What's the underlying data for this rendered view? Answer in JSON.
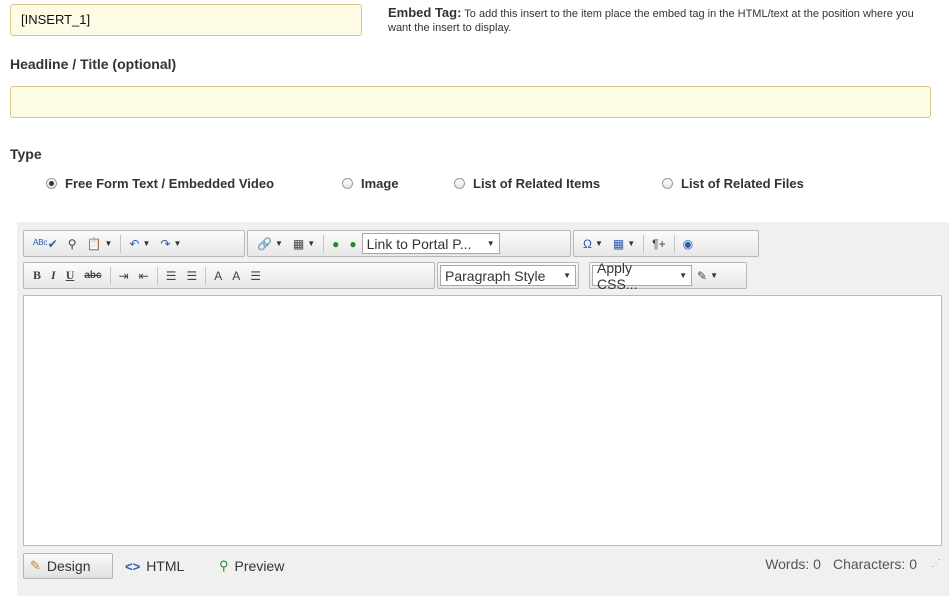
{
  "embed": {
    "value": "[INSERT_1]",
    "tag_label": "Embed Tag:",
    "tag_help": "To add this insert to the item place the embed tag in the HTML/text at the position where you want the insert to display."
  },
  "headline": {
    "label": "Headline / Title (optional)",
    "value": ""
  },
  "type": {
    "label": "Type",
    "options": [
      {
        "label": "Free Form Text / Embedded Video",
        "selected": true
      },
      {
        "label": "Image",
        "selected": false
      },
      {
        "label": "List of Related Items",
        "selected": false
      },
      {
        "label": "List of Related Files",
        "selected": false
      }
    ]
  },
  "editor": {
    "link_combo": "Link to Portal P...",
    "paragraph_combo": "Paragraph Style",
    "css_combo": "Apply CSS...",
    "toolbar_glyphs": {
      "spell": "ᴬᴮᶜ✔",
      "find": "⚲",
      "paste": "📋",
      "undo": "↶",
      "redo": "↷",
      "link": "🔗",
      "media": "▦",
      "web1": "●",
      "web2": "●",
      "omega": "Ω",
      "table": "▦",
      "para": "¶+",
      "shield": "◉",
      "bold": "B",
      "italic": "I",
      "underline": "U",
      "strike": "abc",
      "indent": "⇥",
      "outdent": "⇤",
      "ol": "☰",
      "ul": "☰",
      "sort1": "A",
      "sort2": "A",
      "align": "☰",
      "brush": "✎"
    },
    "modes": {
      "design": "Design",
      "html": "HTML",
      "preview": "Preview"
    },
    "words": "Words: 0",
    "characters": "Characters: 0"
  }
}
